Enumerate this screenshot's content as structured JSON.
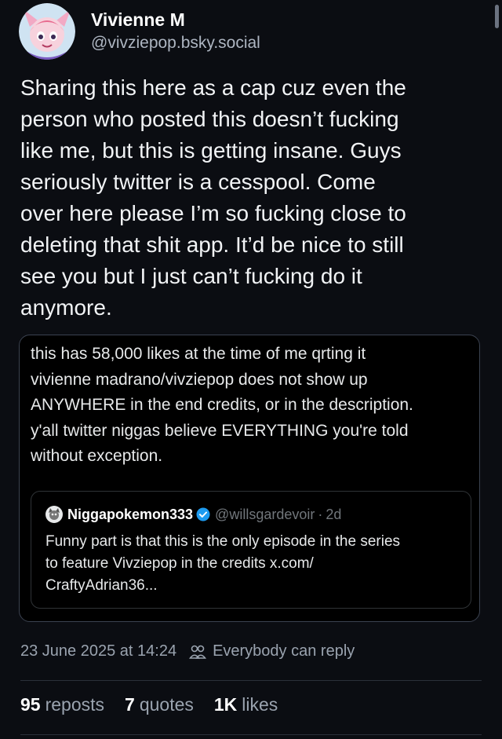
{
  "author": {
    "display_name": "Vivienne M",
    "handle": "@vivziepop.bsky.social"
  },
  "post": {
    "text": "Sharing this here as a cap cuz even the\nperson who posted this doesn’t fucking\nlike me, but this is getting insane. Guys\nseriously twitter is a cesspool. Come\nover here please I’m so fucking close to\ndeleting that shit app. It’d be nice to still\nsee you but I just can’t fucking do it\nanymore."
  },
  "quote": {
    "text": "this has 58,000 likes at the time of me qrting it\nvivienne madrano/vivziepop does not show up\nANYWHERE in the end credits, or in the description.\ny'all twitter niggas believe EVERYTHING you're told\nwithout exception.",
    "inner": {
      "name": "Niggapokemon333",
      "handle": "@willsgardevoir",
      "separator": "·",
      "time": "2d",
      "text": "Funny part is that this is the only episode in the series\nto feature Vivziepop in the credits x.com/\nCraftyAdrian36..."
    }
  },
  "meta": {
    "timestamp": "23 June 2025 at 14:24",
    "reply_setting": "Everybody can reply"
  },
  "stats": {
    "reposts_count": "95",
    "reposts_label": "reposts",
    "quotes_count": "7",
    "quotes_label": "quotes",
    "likes_count": "1K",
    "likes_label": "likes"
  },
  "icons": {
    "avatar": "cartoon-avatar-icon",
    "inner_avatar": "cartoon-avatar-icon",
    "verified": "verified-badge-icon",
    "reply_setting": "people-icon"
  },
  "colors": {
    "background": "#0b0d12",
    "text": "#f1f3f5",
    "muted": "#9aa3af",
    "verified": "#1d9bf0",
    "card_border": "#3b4250"
  }
}
